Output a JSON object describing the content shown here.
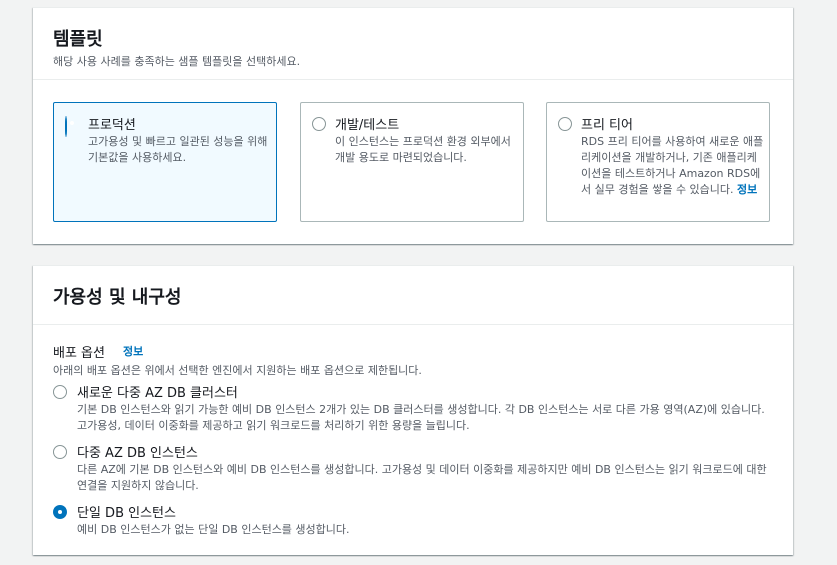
{
  "template_section": {
    "title": "템플릿",
    "description": "해당 사용 사례를 충족하는 샘플 템플릿을 선택하세요.",
    "tiles": [
      {
        "label": "프로덕션",
        "description": "고가용성 및 빠르고 일관된 성능을 위해 기본값을 사용하세요.",
        "selected": true
      },
      {
        "label": "개발/테스트",
        "description": "이 인스턴스는 프로덕션 환경 외부에서 개발 용도로 마련되었습니다.",
        "selected": false
      },
      {
        "label": "프리 티어",
        "description": "RDS 프리 티어를 사용하여 새로운 애플리케이션을 개발하거나, 기존 애플리케이션을 테스트하거나 Amazon RDS에서 실무 경험을 쌓을 수 있습니다.",
        "info_link": "정보",
        "selected": false
      }
    ]
  },
  "availability_section": {
    "title": "가용성 및 내구성",
    "deploy_label": "배포 옵션",
    "info_link": "정보",
    "deploy_description": "아래의 배포 옵션은 위에서 선택한 엔진에서 지원하는 배포 옵션으로 제한됩니다.",
    "options": [
      {
        "label": "새로운 다중 AZ DB 클러스터",
        "description": "기본 DB 인스턴스와 읽기 가능한 예비 DB 인스턴스 2개가 있는 DB 클러스터를 생성합니다. 각 DB 인스턴스는 서로 다른 가용 영역(AZ)에 있습니다. 고가용성, 데이터 이중화를 제공하고 읽기 워크로드를 처리하기 위한 용량을 늘립니다.",
        "selected": false
      },
      {
        "label": "다중 AZ DB 인스턴스",
        "description": "다른 AZ에 기본 DB 인스턴스와 예비 DB 인스턴스를 생성합니다. 고가용성 및 데이터 이중화를 제공하지만 예비 DB 인스턴스는 읽기 워크로드에 대한 연결을 지원하지 않습니다.",
        "selected": false
      },
      {
        "label": "단일 DB 인스턴스",
        "description": "예비 DB 인스턴스가 없는 단일 DB 인스턴스를 생성합니다.",
        "selected": true
      }
    ]
  },
  "colors": {
    "accent": "#0073bb",
    "selected_bg": "#f1faff",
    "page_bg": "#f2f3f3",
    "muted_text": "#545b64"
  }
}
